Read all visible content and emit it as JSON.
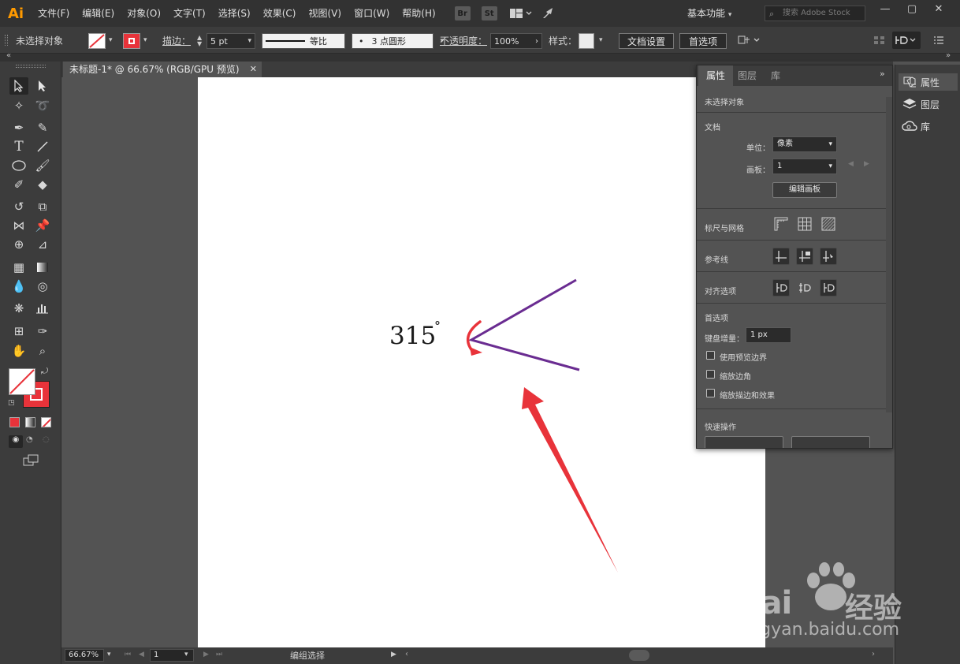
{
  "app": {
    "logo": "Ai",
    "menus": [
      "文件(F)",
      "编辑(E)",
      "对象(O)",
      "文字(T)",
      "选择(S)",
      "效果(C)",
      "视图(V)",
      "窗口(W)",
      "帮助(H)"
    ],
    "bridge_label": "Br",
    "stock_label": "St",
    "workspace": "基本功能",
    "search_placeholder": "搜索 Adobe Stock"
  },
  "control_bar": {
    "selection": "未选择对象",
    "stroke_label": "描边：",
    "stroke_weight": "5 pt",
    "profile_label": "等比",
    "brush_label": "3 点圆形",
    "opacity_label": "不透明度：",
    "opacity_value": "100%",
    "style_label": "样式：",
    "doc_setup": "文档设置",
    "preferences": "首选项"
  },
  "document": {
    "tab_title": "未标题-1* @ 66.67% (RGB/GPU 预览)",
    "angle_text": "315",
    "degree_symbol": "°"
  },
  "status_bar": {
    "zoom": "66.67%",
    "artboard_number": "1",
    "tool_status": "编组选择"
  },
  "properties_panel": {
    "tabs": [
      "属性",
      "图层",
      "库"
    ],
    "no_selection": "未选择对象",
    "document_title": "文档",
    "units_label": "单位：",
    "units_value": "像素",
    "artboard_label": "画板：",
    "artboard_value": "1",
    "edit_artboards": "编辑画板",
    "rulers_grid": "标尺与网格",
    "guides": "参考线",
    "snap_options": "对齐选项",
    "preferences_title": "首选项",
    "keyboard_increment_label": "键盘增量：",
    "keyboard_increment_value": "1 px",
    "use_preview_bounds": "使用预览边界",
    "scale_corners": "缩放边角",
    "scale_strokes": "缩放描边和效果",
    "quick_actions": "快速操作"
  },
  "right_dock": {
    "items": [
      "属性",
      "图层",
      "库"
    ]
  },
  "colors": {
    "chrome_dark": "#323232",
    "chrome": "#3c3c3c",
    "canvas": "#535353",
    "artwork_stroke": "#6a2c91",
    "annotation_red": "#e8333a",
    "accent_orange": "#ff9a00"
  },
  "icons": [
    "selection-tool-icon",
    "direct-selection-tool-icon",
    "pen-tool-icon",
    "type-tool-icon",
    "hand-tool-icon",
    "zoom-tool-icon",
    "search-icon",
    "close-icon"
  ],
  "watermark": {
    "brand": "Bai",
    "brand_suffix": "经验",
    "url": "jingyan.baidu.com"
  }
}
